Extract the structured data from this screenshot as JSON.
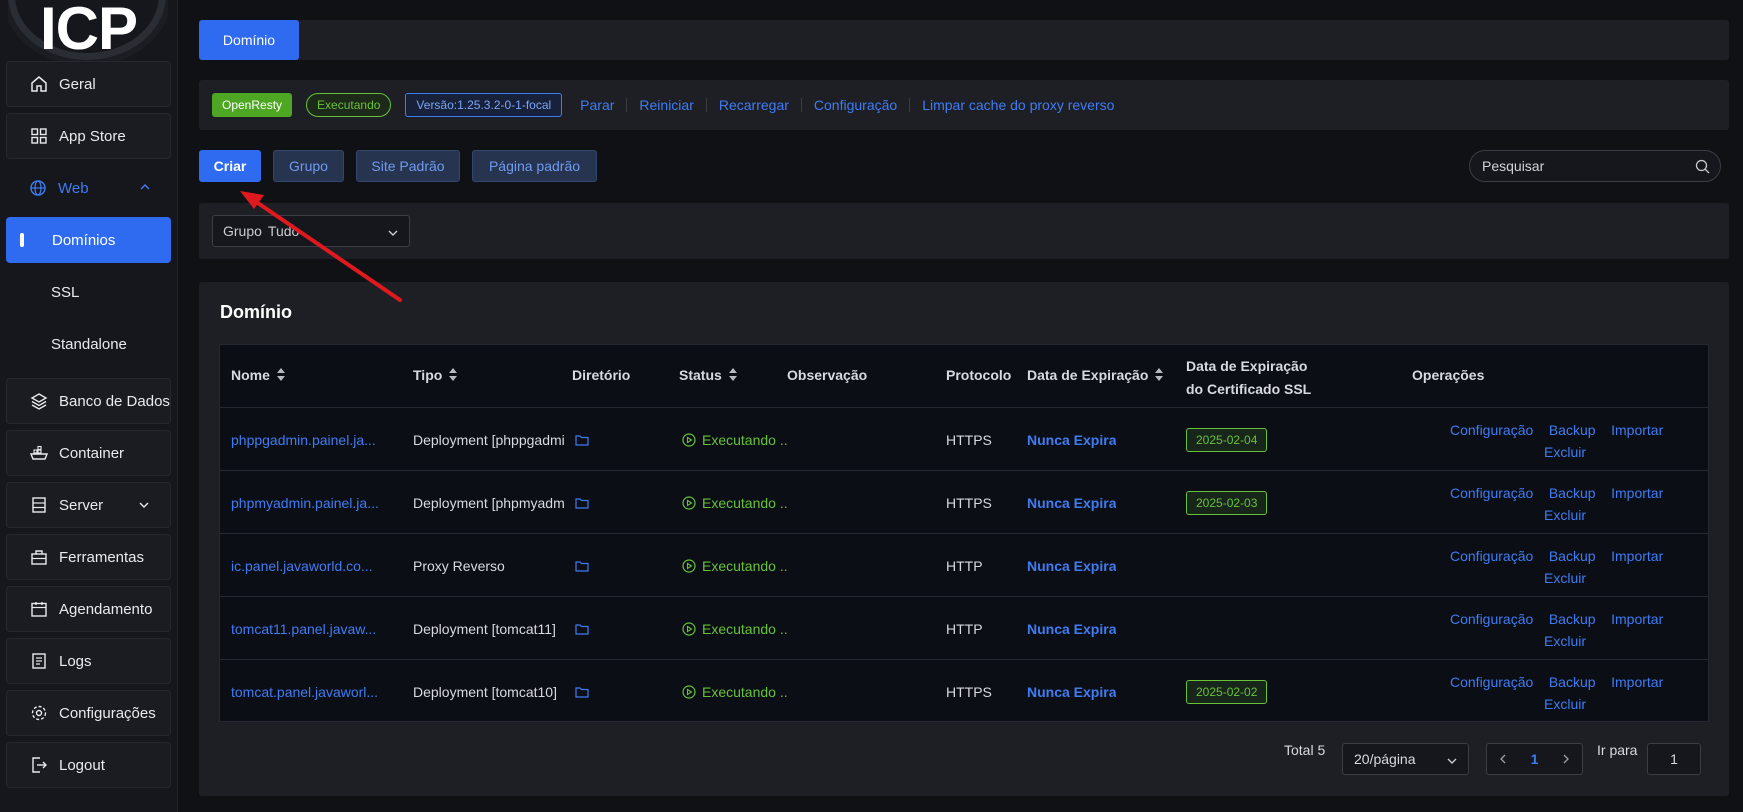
{
  "logo": {
    "text": "ICP"
  },
  "sidebar": {
    "items": [
      {
        "label": "Geral",
        "icon": "home-icon"
      },
      {
        "label": "App Store",
        "icon": "grid-icon"
      },
      {
        "label": "Web",
        "icon": "globe-icon"
      },
      {
        "label": "Domínios"
      },
      {
        "label": "SSL"
      },
      {
        "label": "Standalone"
      },
      {
        "label": "Banco de Dados",
        "icon": "layers-icon"
      },
      {
        "label": "Container",
        "icon": "container-icon"
      },
      {
        "label": "Server",
        "icon": "server-icon"
      },
      {
        "label": "Ferramentas",
        "icon": "toolbox-icon"
      },
      {
        "label": "Agendamento",
        "icon": "calendar-icon"
      },
      {
        "label": "Logs",
        "icon": "logs-icon"
      },
      {
        "label": "Configurações",
        "icon": "gear-icon"
      },
      {
        "label": "Logout",
        "icon": "logout-icon"
      }
    ]
  },
  "tabs": {
    "active": "Domínio"
  },
  "status": {
    "app": "OpenResty",
    "state": "Executando",
    "version": "Versão:1.25.3.2-0-1-focal",
    "actions": [
      "Parar",
      "Reiniciar",
      "Recarregar",
      "Configuração",
      "Limpar cache do proxy reverso"
    ]
  },
  "toolbar": {
    "create": "Criar",
    "group": "Grupo",
    "default_site": "Site Padrão",
    "default_page": "Página padrão",
    "search_placeholder": "Pesquisar"
  },
  "filter": {
    "group_label": "Grupo",
    "group_value": "Tudo"
  },
  "table": {
    "title": "Domínio",
    "headers": {
      "name": "Nome",
      "type": "Tipo",
      "dir": "Diretório",
      "status": "Status",
      "note": "Observação",
      "protocol": "Protocolo",
      "expiry": "Data de Expiração",
      "ssl_expiry_1": "Data de Expiração",
      "ssl_expiry_2": "do Certificado SSL",
      "ops": "Operações"
    },
    "rows": [
      {
        "name": "phppgadmin.painel.ja...",
        "type": "Deployment [phppgadmin",
        "status": "Executando ..",
        "protocol": "HTTPS",
        "expiry": "Nunca Expira",
        "ssl": "2025-02-04"
      },
      {
        "name": "phpmyadmin.painel.ja...",
        "type": "Deployment [phpmyadmin",
        "status": "Executando ..",
        "protocol": "HTTPS",
        "expiry": "Nunca Expira",
        "ssl": "2025-02-03"
      },
      {
        "name": "ic.panel.javaworld.co...",
        "type": "Proxy Reverso",
        "status": "Executando ..",
        "protocol": "HTTP",
        "expiry": "Nunca Expira",
        "ssl": ""
      },
      {
        "name": "tomcat11.panel.javaw...",
        "type": "Deployment [tomcat11]",
        "status": "Executando ..",
        "protocol": "HTTP",
        "expiry": "Nunca Expira",
        "ssl": ""
      },
      {
        "name": "tomcat.panel.javaworl...",
        "type": "Deployment [tomcat10]",
        "status": "Executando ..",
        "protocol": "HTTPS",
        "expiry": "Nunca Expira",
        "ssl": "2025-02-02"
      }
    ],
    "ops": {
      "config": "Configuração",
      "backup": "Backup",
      "import": "Importar",
      "delete": "Excluir"
    }
  },
  "pagination": {
    "total": "Total 5",
    "page_size": "20/página",
    "current": "1",
    "goto_label": "Ir para",
    "goto_value": "1"
  },
  "colors": {
    "accent": "#2f6bf0",
    "success": "#67c23a",
    "annotation_arrow": "#e0191f"
  }
}
